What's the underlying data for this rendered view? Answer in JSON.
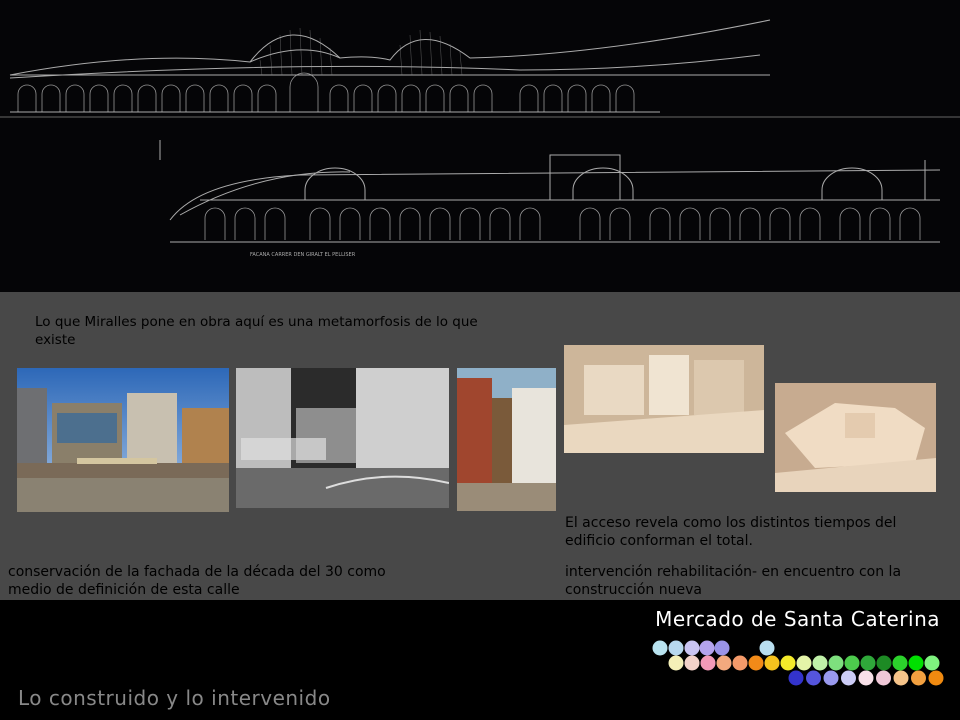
{
  "slide": {
    "title": "Mercado de Santa Caterina",
    "subtitle": "Lo construido y lo intervenido"
  },
  "drawing": {
    "caption": "FACANA CARRER DEN GIRALT EL PELLISER"
  },
  "captions": {
    "intro": "Lo que Miralles pone en obra aquí es una metamorfosis de lo que existe",
    "left": "conservación de la fachada de la década del 30 como medio de definición de esta calle",
    "right_top": "El acceso revela como los distintos tiempos del edificio conforman el total.",
    "right_bottom": " intervención rehabilitación- en encuentro con la construcción nueva"
  },
  "photos": [
    "street-photo-color",
    "street-photo-bw",
    "street-photo-narrow",
    "model-photo-1",
    "model-photo-2"
  ],
  "palette": {
    "row1": [
      "#b9e3f0",
      "#b7d8ee",
      "#c9c4f2",
      "#b4a3ee",
      "#9a93e8",
      "#b9dff0"
    ],
    "row2": [
      "#f4f0b8",
      "#f2d2c9",
      "#f39ab8",
      "#f3a97e",
      "#f49a6a",
      "#f28a18",
      "#f6c21e",
      "#f4ea2a",
      "#e4f4a8",
      "#c0f0a8",
      "#7ee07e",
      "#4dcb4d",
      "#2fa83a",
      "#1d8a24",
      "#2cd22c",
      "#00e000",
      "#7ff27f"
    ],
    "row3": [
      "#3333cc",
      "#5555dd",
      "#9999ee",
      "#ccccf6",
      "#f8e0e8",
      "#f0c8d8",
      "#f6c48a",
      "#f2a040",
      "#f08a10"
    ]
  }
}
